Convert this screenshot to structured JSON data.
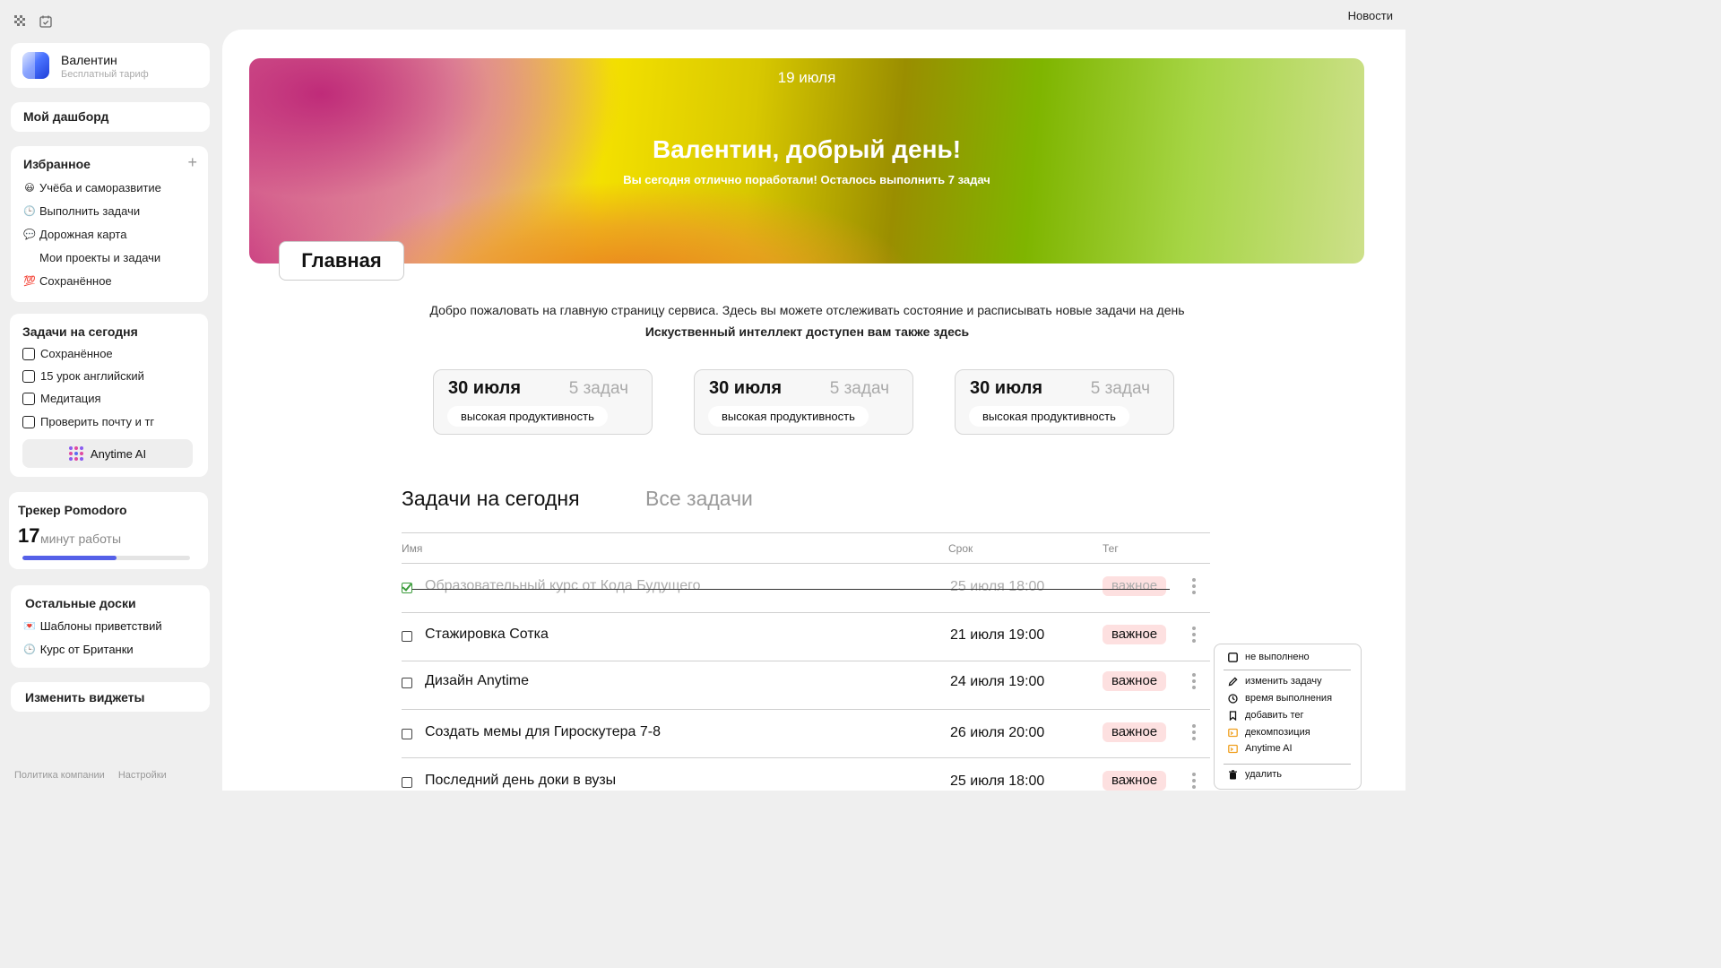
{
  "topbar": {
    "news": "Новости"
  },
  "profile": {
    "name": "Валентин",
    "plan": "Бесплатный тариф"
  },
  "dashboard": {
    "label": "Мой дашборд"
  },
  "favorites": {
    "title": "Избранное",
    "items": [
      {
        "emoji": "😃",
        "label": "Учёба и саморазвитие"
      },
      {
        "emoji": "🕒",
        "label": "Выполнить задачи"
      },
      {
        "emoji": "💬",
        "label": "Дорожная карта"
      },
      {
        "emoji": "",
        "label": "Мои проекты и задачи"
      },
      {
        "emoji": "💯",
        "label": "Сохранённое"
      }
    ]
  },
  "today_widget": {
    "title": "Задачи на сегодня",
    "items": [
      "Сохранённое",
      "15 урок английский",
      "Медитация",
      "Проверить почту и тг"
    ],
    "ai_button": "Anytime AI"
  },
  "pomodoro": {
    "title": "Трекер Pomodoro",
    "minutes": "17",
    "unit": "минут работы",
    "progress": 0.56
  },
  "other_boards": {
    "title": "Остальные доски",
    "items": [
      {
        "emoji": "💌",
        "label": "Шаблоны приветствий"
      },
      {
        "emoji": "🕒",
        "label": "Курс от Британки"
      }
    ]
  },
  "widgets": {
    "label": "Изменить виджеты"
  },
  "footer": {
    "policy": "Политика компании",
    "settings": "Настройки"
  },
  "hero": {
    "date": "19 июля",
    "title": "Валентин, добрый день!",
    "subtitle": "Вы сегодня отлично поработали! Осталось выполнить 7 задач"
  },
  "page_tab": "Главная",
  "intro": {
    "line1": "Добро пожаловать на главную страницу сервиса. Здесь вы можете отслеживать состояние и расписывать новые задачи на день",
    "line2": "Искуственный интеллект доступен вам также здесь"
  },
  "stats": [
    {
      "date": "30 июля",
      "count": "5 задач",
      "label": "высокая продуктивность"
    },
    {
      "date": "30 июля",
      "count": "5 задач",
      "label": "высокая продуктивность"
    },
    {
      "date": "30 июля",
      "count": "5 задач",
      "label": "высокая продуктивность"
    }
  ],
  "tabs": {
    "today": "Задачи на сегодня",
    "all": "Все задачи"
  },
  "table": {
    "headers": {
      "name": "Имя",
      "due": "Срок",
      "tag": "Тег"
    },
    "rows": [
      {
        "name": "Образовательный курс от Кода Будущего",
        "due": "25 июля 18:00",
        "tag": "важное",
        "done": true
      },
      {
        "name": "Стажировка Сотка",
        "due": "21 июля 19:00",
        "tag": "важное",
        "done": false
      },
      {
        "name": "Дизайн Anytime",
        "due": "24 июля 19:00",
        "tag": "важное",
        "done": false
      },
      {
        "name": "Создать мемы для Гироскутера 7-8",
        "due": "26 июля 20:00",
        "tag": "важное",
        "done": false
      },
      {
        "name": "Последний день доки в вузы",
        "due": "25 июля 18:00",
        "tag": "важное",
        "done": false
      }
    ]
  },
  "context_menu": {
    "not_done": "не выполнено",
    "edit": "изменить задачу",
    "time": "время выполнения",
    "add_tag": "добавить тег",
    "decompose": "декомпозиция",
    "ai": "Anytime AI",
    "delete": "удалить"
  },
  "colors": {
    "accent": "#5560e8",
    "tag_bg": "#fde0e0",
    "done_check": "#3a9b3a",
    "menu_icon_orange": "#f0a020"
  }
}
